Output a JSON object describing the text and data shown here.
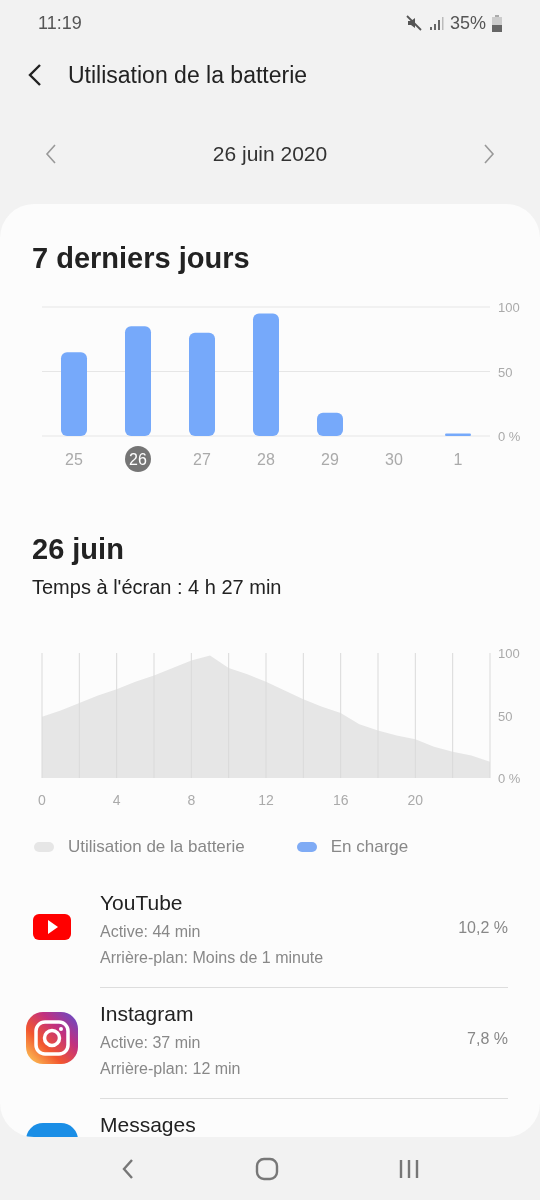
{
  "status_bar": {
    "time": "11:19",
    "battery": "35%"
  },
  "header": {
    "title": "Utilisation de la batterie"
  },
  "date_nav": {
    "date": "26 juin 2020"
  },
  "weekly": {
    "title": "7 derniers jours",
    "chart_data": {
      "type": "bar",
      "categories": [
        "25",
        "26",
        "27",
        "28",
        "29",
        "30",
        "1"
      ],
      "series": [
        {
          "color": "#76a9fa",
          "values": [
            65,
            85,
            80,
            95,
            18,
            0,
            2
          ]
        }
      ],
      "ylim": [
        0,
        100
      ],
      "yticks": [
        {
          "value": 0,
          "label": "0 %"
        },
        {
          "value": 50,
          "label": "50"
        },
        {
          "value": 100,
          "label": "100"
        }
      ],
      "grid": true
    },
    "days": [
      {
        "selected": false
      },
      {
        "selected": true
      },
      {
        "selected": false
      },
      {
        "selected": false
      },
      {
        "selected": false
      },
      {
        "selected": false
      },
      {
        "selected": false
      }
    ]
  },
  "day": {
    "title": "26 juin",
    "screen_time": "Temps à l'écran : 4 h 27 min",
    "chart_data": {
      "type": "area",
      "x": [
        0,
        1,
        2,
        3,
        4,
        5,
        6,
        7,
        8,
        9,
        10,
        11,
        12,
        13,
        14,
        15,
        16,
        17,
        18,
        19,
        20,
        21,
        22,
        23,
        24
      ],
      "series": [
        {
          "name": "Utilisation de la batterie",
          "color": "#e6e6e6",
          "values": [
            49,
            54,
            60,
            66,
            71,
            77,
            82,
            88,
            94,
            98,
            88,
            83,
            77,
            70,
            63,
            57,
            52,
            43,
            38,
            34,
            31,
            25,
            21,
            18,
            13
          ]
        },
        {
          "name": "En charge",
          "color": "#7fabf5",
          "values": [
            null,
            null,
            null,
            null,
            null,
            null,
            null,
            null,
            null,
            null,
            null,
            null,
            null,
            null,
            null,
            null,
            null,
            null,
            null,
            null,
            null,
            null,
            null,
            null,
            null
          ]
        }
      ],
      "xlim": [
        0,
        24
      ],
      "ylim": [
        0,
        100
      ],
      "grid": true,
      "xticks": [
        0,
        4,
        8,
        12,
        16,
        20
      ],
      "yticks": [
        {
          "value": 0,
          "label": "0 %"
        },
        {
          "value": 50,
          "label": "50"
        },
        {
          "value": 100,
          "label": "100"
        }
      ]
    }
  },
  "apps": [
    {
      "kind": "youtube",
      "name": "YouTube",
      "active": "Active: 44 min",
      "background": "Arrière-plan: Moins de 1 minute",
      "percent": "10,2 %"
    },
    {
      "kind": "instagram",
      "name": "Instagram",
      "active": "Active: 37 min",
      "background": "Arrière-plan: 12 min",
      "percent": "7,8 %"
    },
    {
      "kind": "messages",
      "name": "Messages"
    }
  ]
}
